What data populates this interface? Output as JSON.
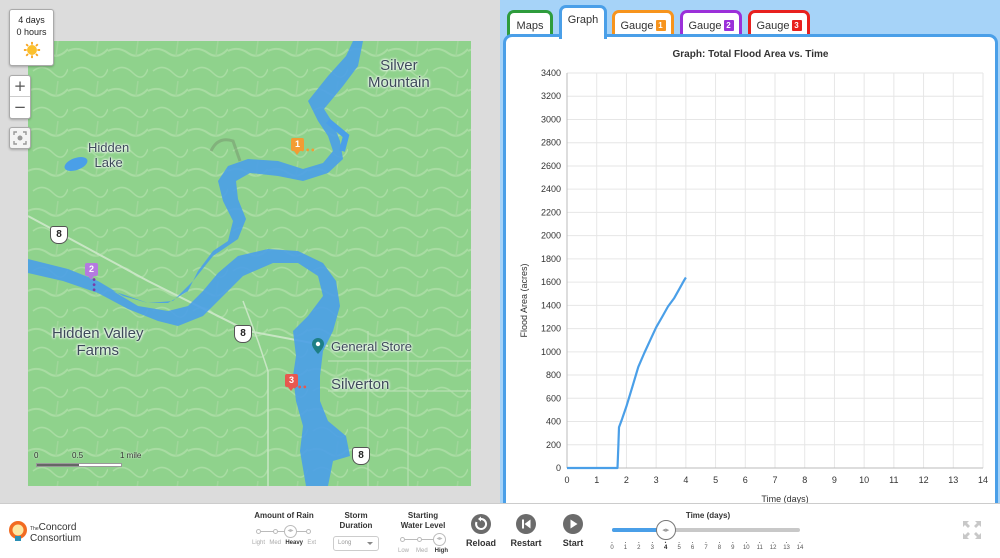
{
  "time_display": {
    "days": "4 days",
    "hours": "0 hours",
    "weather_icon": "sun-icon"
  },
  "map": {
    "zoom_in_label": "+",
    "zoom_out_label": "−",
    "recenter_icon": "recenter-icon",
    "labels": {
      "silver_mountain": "Silver\nMountain",
      "hidden_lake": "Hidden\nLake",
      "hidden_valley_farms": "Hidden Valley\nFarms",
      "general_store": "General Store",
      "silverton": "Silverton"
    },
    "route_shields": [
      "8",
      "8",
      "8"
    ],
    "gauges": [
      {
        "id": "1",
        "color": "#f39c33"
      },
      {
        "id": "2",
        "color": "#b57ae0"
      },
      {
        "id": "3",
        "color": "#e8584f"
      }
    ],
    "scale": {
      "labels": [
        "0",
        "0.5",
        "1 mile"
      ]
    }
  },
  "tabs": [
    {
      "label": "Maps",
      "color": "#2e9c3c",
      "active": false
    },
    {
      "label": "Graph",
      "color": "#4a9fe8",
      "active": true
    },
    {
      "label": "Gauge",
      "badge": "1",
      "color": "#f7941d",
      "active": false
    },
    {
      "label": "Gauge",
      "badge": "2",
      "color": "#9b30d9",
      "active": false
    },
    {
      "label": "Gauge",
      "badge": "3",
      "color": "#e8201e",
      "active": false
    }
  ],
  "chart_data": {
    "type": "line",
    "title": "Graph: Total Flood Area vs. Time",
    "xlabel": "Time (days)",
    "ylabel": "Flood Area (acres)",
    "xlim": [
      0,
      14
    ],
    "ylim": [
      0,
      3400
    ],
    "x_ticks": [
      0,
      1,
      2,
      3,
      4,
      5,
      6,
      7,
      8,
      9,
      10,
      11,
      12,
      13,
      14
    ],
    "y_ticks": [
      0,
      200,
      400,
      600,
      800,
      1000,
      1200,
      1400,
      1600,
      1800,
      2000,
      2200,
      2400,
      2600,
      2800,
      3000,
      3200,
      3400
    ],
    "grid": true,
    "series": [
      {
        "name": "Total Flood Area",
        "color": "#4a9fe8",
        "x": [
          0,
          1.7,
          1.73,
          1.75,
          1.85,
          2.0,
          2.2,
          2.4,
          2.6,
          2.8,
          3.0,
          3.2,
          3.4,
          3.6,
          3.8,
          3.95,
          4.0
        ],
        "y": [
          0,
          0,
          200,
          350,
          420,
          530,
          700,
          870,
          990,
          1100,
          1210,
          1300,
          1390,
          1460,
          1550,
          1620,
          1640
        ]
      }
    ]
  },
  "controls": {
    "rain": {
      "title": "Amount of Rain",
      "options": [
        "Light",
        "Med",
        "Heavy",
        "Ext"
      ],
      "selected": "Heavy"
    },
    "storm": {
      "title_line1": "Storm",
      "title_line2": "Duration",
      "value": "Long"
    },
    "water": {
      "title_line1": "Starting",
      "title_line2": "Water Level",
      "options": [
        "Low",
        "Med",
        "High"
      ],
      "selected": "High"
    },
    "reload_label": "Reload",
    "restart_label": "Restart",
    "start_label": "Start",
    "time_slider": {
      "title": "Time (days)",
      "ticks": [
        "0",
        "1",
        "2",
        "3",
        "4",
        "5",
        "6",
        "7",
        "8",
        "9",
        "10",
        "11",
        "12",
        "13",
        "14"
      ],
      "value": 4,
      "max": 14
    }
  },
  "logo": {
    "the": "The",
    "line1": "Concord",
    "line2": "Consortium"
  }
}
